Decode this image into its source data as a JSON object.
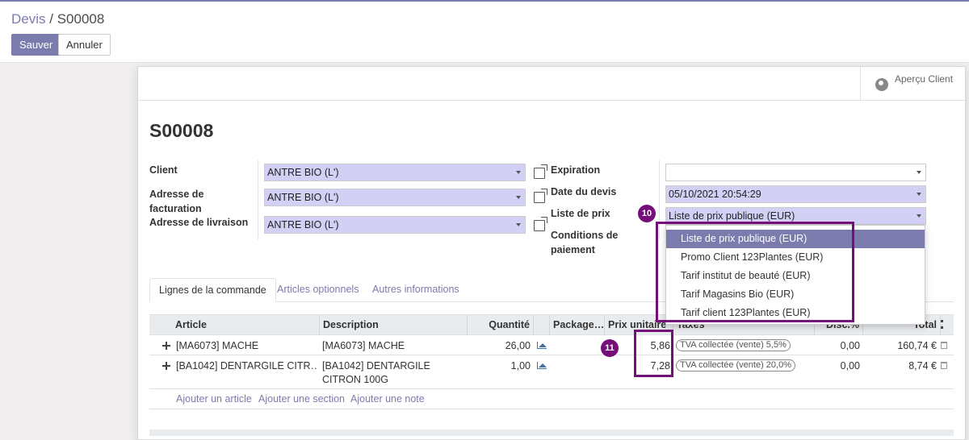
{
  "breadcrumb": {
    "parent": "Devis",
    "separator": "/",
    "current": "S00008"
  },
  "toolbar": {
    "save_label": "Sauver",
    "cancel_label": "Annuler"
  },
  "stat_button": {
    "label": "Aperçu Client",
    "icon": "globe-icon"
  },
  "form": {
    "title": "S00008",
    "client_label": "Client",
    "client_value": "ANTRE BIO (L')",
    "invoice_address_label": "Adresse de facturation",
    "invoice_address_value": "ANTRE BIO (L')",
    "delivery_address_label": "Adresse de livraison",
    "delivery_address_value": "ANTRE BIO (L')",
    "expiration_label": "Expiration",
    "expiration_value": "",
    "quote_date_label": "Date du devis",
    "quote_date_value": "05/10/2021 20:54:29",
    "pricelist_label": "Liste de prix",
    "pricelist_value": "Liste de prix publique (EUR)",
    "payment_terms_label": "Conditions de paiement"
  },
  "pricelist_dropdown": {
    "options": [
      "Liste de prix publique (EUR)",
      "Promo Client 123Plantes (EUR)",
      "Tarif institut de beauté (EUR)",
      "Tarif Magasins Bio (EUR)",
      "Tarif client 123Plantes (EUR)"
    ],
    "selected_index": 0
  },
  "annotations": {
    "badge_pricelist": "10",
    "badge_unit_price": "11",
    "color": "#760e7a"
  },
  "tabs": [
    "Lignes de la commande",
    "Articles optionnels",
    "Autres informations"
  ],
  "table": {
    "headers": {
      "article": "Article",
      "description": "Description",
      "quantity": "Quantité",
      "packaging": "Package…",
      "unit_price": "Prix unitaire",
      "taxes": "Taxes",
      "discount": "Disc.%",
      "total": "Total"
    },
    "rows": [
      {
        "article": "[MA6073] MACHE",
        "description": "[MA6073] MACHE",
        "quantity": "26,00",
        "unit_price": "5,86",
        "tax": "TVA collectée (vente) 5,5%",
        "discount": "0,00",
        "total": "160,74 €"
      },
      {
        "article": "[BA1042] DENTARGILE CITR…",
        "description": "[BA1042] DENTARGILE CITRON 100G",
        "quantity": "1,00",
        "unit_price": "7,28",
        "tax": "TVA collectée (vente) 20,0%",
        "discount": "0,00",
        "total": "8,74 €"
      }
    ],
    "add_links": [
      "Ajouter un article",
      "Ajouter une section",
      "Ajouter une note"
    ]
  },
  "colors": {
    "brand": "#7c7bad",
    "selection_bg": "#d2d0f5",
    "highlight": "#760e7a"
  }
}
